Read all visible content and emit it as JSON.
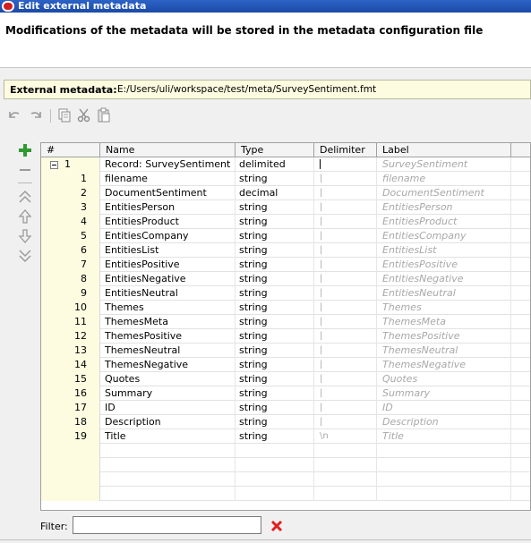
{
  "window": {
    "title": "Edit external metadata",
    "icon": "oracle-icon"
  },
  "header": {
    "message": "Modifications of the metadata will be stored in the metadata configuration file"
  },
  "file": {
    "label": "External metadata:",
    "path": "E:/Users/uli/workspace/test/meta/SurveySentiment.fmt"
  },
  "toolbar": {
    "icons": [
      "undo-icon",
      "redo-icon",
      "copy-icon",
      "cut-icon",
      "paste-icon"
    ]
  },
  "side_toolbar": {
    "icons": [
      "add-icon",
      "remove-icon",
      "move-top-icon",
      "move-up-icon",
      "move-down-icon",
      "move-bottom-icon"
    ]
  },
  "table": {
    "headers": {
      "num": "#",
      "name": "Name",
      "type": "Type",
      "delimiter": "Delimiter",
      "label": "Label"
    },
    "record": {
      "num": "1",
      "name": "Record: SurveySentiment",
      "type": "delimited",
      "delimiter": "",
      "label": "SurveySentiment"
    },
    "rows": [
      {
        "num": "1",
        "name": "filename",
        "type": "string",
        "delimiter": "|",
        "label": "filename"
      },
      {
        "num": "2",
        "name": "DocumentSentiment",
        "type": "decimal",
        "delimiter": "|",
        "label": "DocumentSentiment"
      },
      {
        "num": "3",
        "name": "EntitiesPerson",
        "type": "string",
        "delimiter": "|",
        "label": "EntitiesPerson"
      },
      {
        "num": "4",
        "name": "EntitiesProduct",
        "type": "string",
        "delimiter": "|",
        "label": "EntitiesProduct"
      },
      {
        "num": "5",
        "name": "EntitiesCompany",
        "type": "string",
        "delimiter": "|",
        "label": "EntitiesCompany"
      },
      {
        "num": "6",
        "name": "EntitiesList",
        "type": "string",
        "delimiter": "|",
        "label": "EntitiesList"
      },
      {
        "num": "7",
        "name": "EntitiesPositive",
        "type": "string",
        "delimiter": "|",
        "label": "EntitiesPositive"
      },
      {
        "num": "8",
        "name": "EntitiesNegative",
        "type": "string",
        "delimiter": "|",
        "label": "EntitiesNegative"
      },
      {
        "num": "9",
        "name": "EntitiesNeutral",
        "type": "string",
        "delimiter": "|",
        "label": "EntitiesNeutral"
      },
      {
        "num": "10",
        "name": "Themes",
        "type": "string",
        "delimiter": "|",
        "label": "Themes"
      },
      {
        "num": "11",
        "name": "ThemesMeta",
        "type": "string",
        "delimiter": "|",
        "label": "ThemesMeta"
      },
      {
        "num": "12",
        "name": "ThemesPositive",
        "type": "string",
        "delimiter": "|",
        "label": "ThemesPositive"
      },
      {
        "num": "13",
        "name": "ThemesNeutral",
        "type": "string",
        "delimiter": "|",
        "label": "ThemesNeutral"
      },
      {
        "num": "14",
        "name": "ThemesNegative",
        "type": "string",
        "delimiter": "|",
        "label": "ThemesNegative"
      },
      {
        "num": "15",
        "name": "Quotes",
        "type": "string",
        "delimiter": "|",
        "label": "Quotes"
      },
      {
        "num": "16",
        "name": "Summary",
        "type": "string",
        "delimiter": "|",
        "label": "Summary"
      },
      {
        "num": "17",
        "name": "ID",
        "type": "string",
        "delimiter": "|",
        "label": "ID"
      },
      {
        "num": "18",
        "name": "Description",
        "type": "string",
        "delimiter": "|",
        "label": "Description"
      },
      {
        "num": "19",
        "name": "Title",
        "type": "string",
        "delimiter": "\\n",
        "label": "Title"
      }
    ]
  },
  "filter": {
    "label": "Filter:",
    "value": "",
    "clear_icon": "clear-filter-icon"
  },
  "colors": {
    "accent_bg": "#fdfbe0",
    "title_bar": "#2d63c6",
    "delete_red": "#e02020"
  }
}
